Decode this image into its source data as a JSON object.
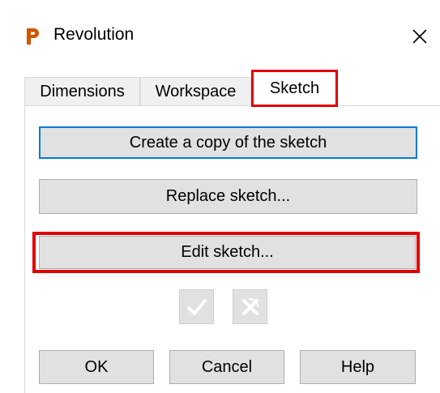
{
  "window": {
    "title": "Revolution",
    "app_icon_letter": "P",
    "app_icon_color": "#d35400",
    "close_icon": "close-icon"
  },
  "tabs": [
    {
      "label": "Dimensions",
      "active": false
    },
    {
      "label": "Workspace",
      "active": false
    },
    {
      "label": "Sketch",
      "active": true
    }
  ],
  "sketch_panel": {
    "copy_button": "Create a copy of the sketch",
    "replace_button": "Replace sketch...",
    "edit_button": "Edit sketch...",
    "accept_icon": "check-icon",
    "reject_icon": "cross-icon"
  },
  "footer": {
    "ok": "OK",
    "cancel": "Cancel",
    "help": "Help"
  },
  "colors": {
    "highlight": "#e00000",
    "focus": "#0078d7",
    "button_bg": "#e1e1e1"
  }
}
